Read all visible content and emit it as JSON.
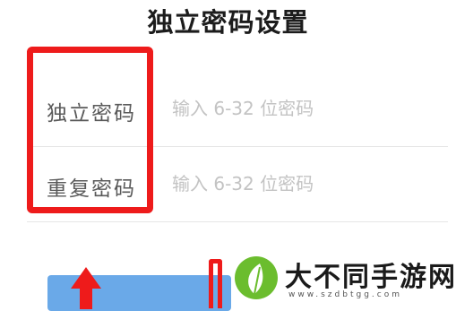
{
  "page_title": "独立密码设置",
  "form": {
    "fields": [
      {
        "label": "独立密码",
        "value": "",
        "placeholder": "输入 6-32 位密码"
      },
      {
        "label": "重复密码",
        "value": "",
        "placeholder": "输入 6-32 位密码"
      }
    ]
  },
  "annotations": {
    "highlight_color": "#ee1b1b"
  },
  "button": {
    "color": "#6aa9e8"
  },
  "watermark": {
    "brand": "大不同手游网",
    "url": "www.szdbtgg.com",
    "logo_icon": "leaf-icon"
  }
}
